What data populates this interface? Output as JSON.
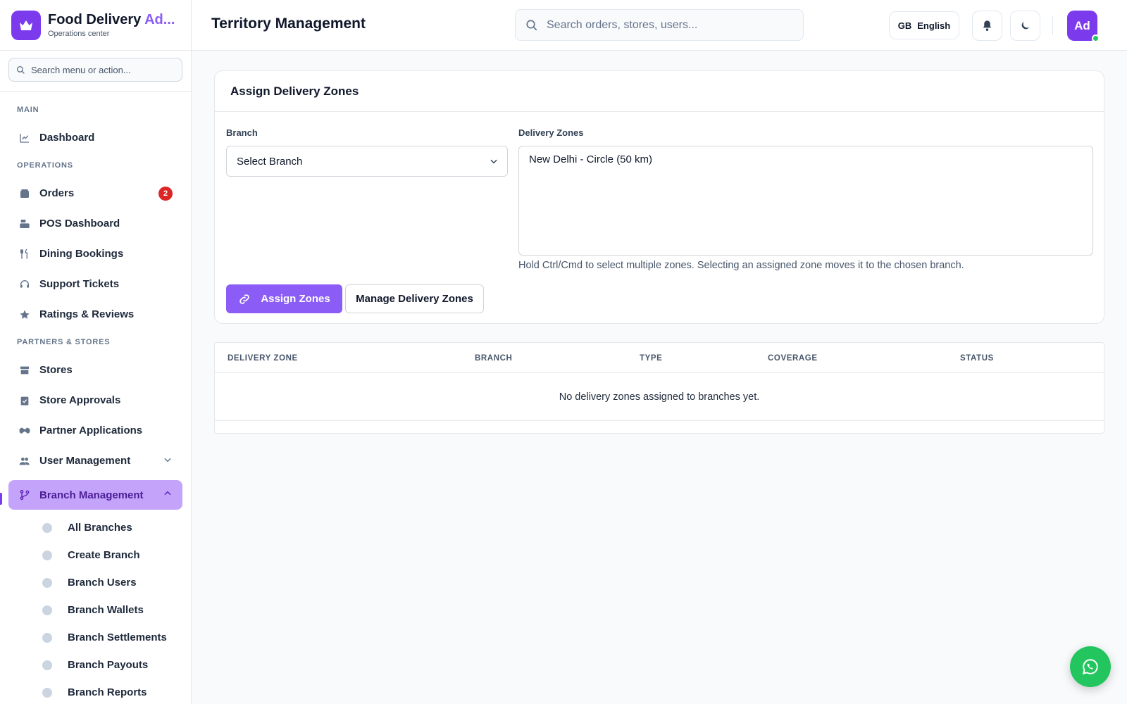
{
  "brand": {
    "title_main": "Food Delivery ",
    "title_accent": "Ad...",
    "subtitle": "Operations center"
  },
  "sidebar": {
    "search_placeholder": "Search menu or action...",
    "sections": {
      "main": "MAIN",
      "operations": "OPERATIONS",
      "partners": "PARTNERS & STORES"
    },
    "items": {
      "dashboard": "Dashboard",
      "orders": "Orders",
      "orders_badge": "2",
      "pos": "POS Dashboard",
      "dining": "Dining Bookings",
      "support": "Support Tickets",
      "ratings": "Ratings & Reviews",
      "stores": "Stores",
      "store_approvals": "Store Approvals",
      "partner_apps": "Partner Applications",
      "user_mgmt": "User Management",
      "branch_mgmt": "Branch Management"
    },
    "branch_sub": [
      "All Branches",
      "Create Branch",
      "Branch Users",
      "Branch Wallets",
      "Branch Settlements",
      "Branch Payouts",
      "Branch Reports"
    ]
  },
  "header": {
    "title": "Territory Management",
    "search_placeholder": "Search orders, stores, users...",
    "lang_code": "GB",
    "lang_label": "English",
    "avatar": "Ad"
  },
  "assign_card": {
    "title": "Assign Delivery Zones",
    "branch_label": "Branch",
    "branch_value": "Select Branch",
    "zones_label": "Delivery Zones",
    "zones_option": "New Delhi - Circle (50 km)",
    "help": "Hold Ctrl/Cmd to select multiple zones. Selecting an assigned zone moves it to the chosen branch.",
    "assign_button": "Assign Zones",
    "manage_button": "Manage Delivery Zones"
  },
  "table": {
    "headers": [
      "DELIVERY ZONE",
      "BRANCH",
      "TYPE",
      "COVERAGE",
      "STATUS"
    ],
    "empty": "No delivery zones assigned to branches yet."
  },
  "colors": {
    "accent": "#8b5cf6",
    "active_bg": "#c4a4fb",
    "badge": "#dc2626",
    "fab": "#22c55e"
  }
}
